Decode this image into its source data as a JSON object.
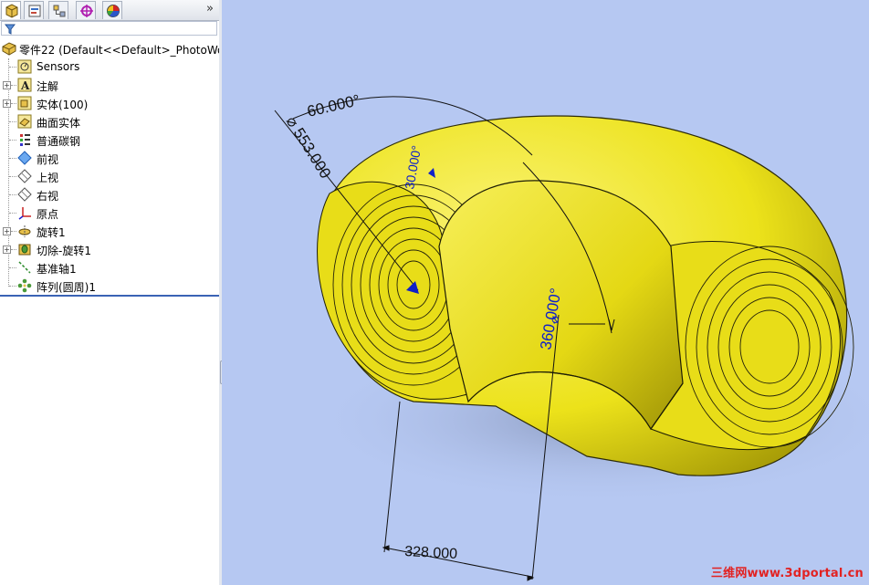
{
  "tabs": [
    {
      "icon": "feature-manager-icon",
      "active": true
    },
    {
      "icon": "property-manager-icon"
    },
    {
      "icon": "configuration-manager-icon"
    },
    {
      "icon": "dimxpert-manager-icon"
    },
    {
      "icon": "display-manager-icon"
    }
  ],
  "tabs_more": "»",
  "filter": {
    "icon": "filter-icon"
  },
  "tree": {
    "root": "零件22  (Default<<Default>_PhotoWo",
    "items": [
      {
        "label": "Sensors",
        "icon": "sensors-icon"
      },
      {
        "label": "注解",
        "icon": "annotations-icon"
      },
      {
        "label": "实体(100)",
        "icon": "solid-bodies-icon"
      },
      {
        "label": "曲面实体",
        "icon": "surface-bodies-icon"
      },
      {
        "label": "普通碳钢",
        "icon": "material-icon"
      },
      {
        "label": "前视",
        "icon": "plane-icon"
      },
      {
        "label": "上视",
        "icon": "plane-icon"
      },
      {
        "label": "右视",
        "icon": "plane-icon"
      },
      {
        "label": "原点",
        "icon": "origin-icon"
      },
      {
        "label": "旋转1",
        "icon": "revolve-icon"
      },
      {
        "label": "切除-旋转1",
        "icon": "cut-revolve-icon"
      },
      {
        "label": "基准轴1",
        "icon": "axis-icon"
      },
      {
        "label": "阵列(圆周)1",
        "icon": "circular-pattern-icon"
      }
    ]
  },
  "dimensions": {
    "angle": "60.000°",
    "diameter": "553.000",
    "diameter_symbol": "⌀",
    "small_angle": "30.000°",
    "full_angle": "360.000°",
    "small_diameter": "⌀",
    "width": "328.000"
  },
  "watermark": "三维网www.3dportal.cn",
  "colors": {
    "viewport": "#b6c8f2",
    "body": "#f0e619",
    "dimension": "#1020c8",
    "watermark": "#e22222"
  }
}
